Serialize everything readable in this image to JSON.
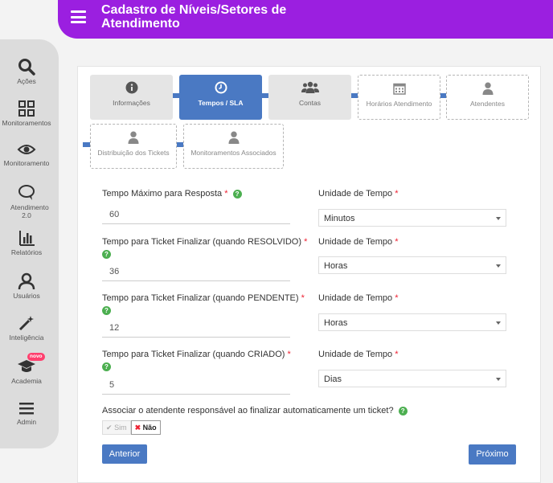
{
  "header": {
    "title": "Cadastro de Níveis/Setores de Atendimento"
  },
  "sidebar": {
    "items": [
      {
        "label": "Ações"
      },
      {
        "label": "Monitoramentos"
      },
      {
        "label": "Monitoramento"
      },
      {
        "label": "Atendimento 2.0"
      },
      {
        "label": "Relatórios"
      },
      {
        "label": "Usuários"
      },
      {
        "label": "Inteligência"
      },
      {
        "label": "Academia",
        "badge": "novo"
      },
      {
        "label": "Admin"
      }
    ]
  },
  "steps": [
    {
      "label": "Informações",
      "state": "done"
    },
    {
      "label": "Tempos / SLA",
      "state": "active"
    },
    {
      "label": "Contas",
      "state": "done"
    },
    {
      "label": "Horários Atendimento",
      "state": "pending"
    },
    {
      "label": "Atendentes",
      "state": "pending"
    },
    {
      "label": "Distribuição dos Tickets",
      "state": "pending"
    },
    {
      "label": "Monitoramentos Associados",
      "state": "pending"
    }
  ],
  "form": {
    "rows": [
      {
        "label": "Tempo Máximo para Resposta",
        "value": "60",
        "unit_label": "Unidade de Tempo",
        "unit": "Minutos"
      },
      {
        "label": "Tempo para Ticket Finalizar (quando RESOLVIDO)",
        "value": "36",
        "unit_label": "Unidade de Tempo",
        "unit": "Horas"
      },
      {
        "label": "Tempo para Ticket Finalizar (quando PENDENTE)",
        "value": "12",
        "unit_label": "Unidade de Tempo",
        "unit": "Horas"
      },
      {
        "label": "Tempo para Ticket Finalizar (quando CRIADO)",
        "value": "5",
        "unit_label": "Unidade de Tempo",
        "unit": "Dias"
      }
    ],
    "required_mark": "*",
    "help_mark": "?",
    "associate_question": "Associar o atendente responsável ao finalizar automaticamente um ticket?",
    "toggle": {
      "yes": "Sim",
      "no": "Não",
      "selected": "Não"
    }
  },
  "buttons": {
    "prev": "Anterior",
    "next": "Próximo"
  },
  "colors": {
    "brand": "#9b1fe0",
    "primary": "#4a79c3",
    "help": "#4caf50",
    "required": "#e23",
    "badge": "#ff3f6e"
  }
}
